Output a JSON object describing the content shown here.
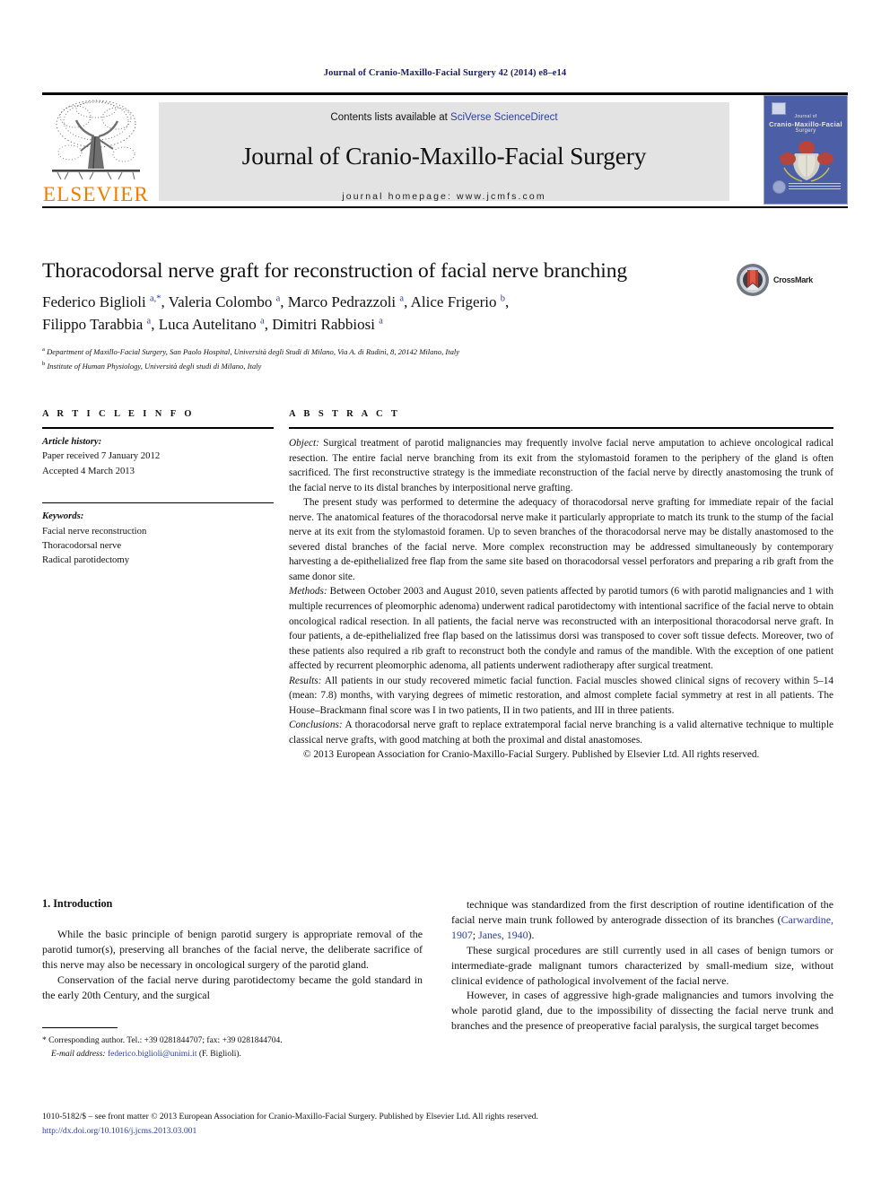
{
  "running_head": "Journal of Cranio-Maxillo-Facial Surgery 42 (2014) e8–e14",
  "masthead": {
    "publisher_logo_text": "ELSEVIER",
    "contents_line_prefix": "Contents lists available at ",
    "contents_line_link": "SciVerse ScienceDirect",
    "journal_title": "Journal of Cranio-Maxillo-Facial Surgery",
    "homepage_line": "journal homepage: www.jcmfs.com",
    "cover": {
      "line1": "Journal of",
      "line2": "Cranio-Maxillo-Facial",
      "line3": "Surgery",
      "bg_color": "#4c5fa6"
    },
    "accent_orange": "#F07D00",
    "link_color": "#2a3fa0"
  },
  "article": {
    "title": "Thoracodorsal nerve graft for reconstruction of facial nerve branching",
    "crossmark_label": "CrossMark",
    "authors_line1": "Federico Biglioli <sup>a,*</sup>, Valeria Colombo <sup>a</sup>, Marco Pedrazzoli <sup>a</sup>, Alice Frigerio <sup>b</sup>,",
    "authors_line2": "Filippo Tarabbia <sup>a</sup>, Luca Autelitano <sup>a</sup>, Dimitri Rabbiosi <sup>a</sup>",
    "affiliation_a": "<sup>a</sup> Department of Maxillo-Facial Surgery, San Paolo Hospital, Università degli Studi di Milano, Via A. di Rudinì, 8, 20142 Milano, Italy",
    "affiliation_b": "<sup>b</sup> Institute of Human Physiology, Università degli studi di Milano, Italy"
  },
  "article_info": {
    "heading": "A R T I C L E   I N F O",
    "history_label": "Article history:",
    "history_lines": [
      "Paper received 7 January 2012",
      "Accepted 4 March 2013"
    ],
    "keywords_label": "Keywords:",
    "keywords": [
      "Facial nerve reconstruction",
      "Thoracodorsal nerve",
      "Radical parotidectomy"
    ]
  },
  "abstract": {
    "heading": "A B S T R A C T",
    "paragraphs": [
      {
        "label": "Object:",
        "indent": false,
        "text": " Surgical treatment of parotid malignancies may frequently involve facial nerve amputation to achieve oncological radical resection. The entire facial nerve branching from its exit from the stylomastoid foramen to the periphery of the gland is often sacrificed. The first reconstructive strategy is the immediate reconstruction of the facial nerve by directly anastomosing the trunk of the facial nerve to its distal branches by interpositional nerve grafting."
      },
      {
        "label": "",
        "indent": true,
        "text": "The present study was performed to determine the adequacy of thoracodorsal nerve grafting for immediate repair of the facial nerve. The anatomical features of the thoracodorsal nerve make it particularly appropriate to match its trunk to the stump of the facial nerve at its exit from the stylomastoid foramen. Up to seven branches of the thoracodorsal nerve may be distally anastomosed to the severed distal branches of the facial nerve. More complex reconstruction may be addressed simultaneously by contemporary harvesting a de-epithelialized free flap from the same site based on thoracodorsal vessel perforators and preparing a rib graft from the same donor site."
      },
      {
        "label": "Methods:",
        "indent": false,
        "text": " Between October 2003 and August 2010, seven patients affected by parotid tumors (6 with parotid malignancies and 1 with multiple recurrences of pleomorphic adenoma) underwent radical parotidectomy with intentional sacrifice of the facial nerve to obtain oncological radical resection. In all patients, the facial nerve was reconstructed with an interpositional thoracodorsal nerve graft. In four patients, a de-epithelialized free flap based on the latissimus dorsi was transposed to cover soft tissue defects. Moreover, two of these patients also required a rib graft to reconstruct both the condyle and ramus of the mandible. With the exception of one patient affected by recurrent pleomorphic adenoma, all patients underwent radiotherapy after surgical treatment."
      },
      {
        "label": "Results:",
        "indent": false,
        "text": " All patients in our study recovered mimetic facial function. Facial muscles showed clinical signs of recovery within 5–14 (mean: 7.8) months, with varying degrees of mimetic restoration, and almost complete facial symmetry at rest in all patients. The House–Brackmann final score was I in two patients, II in two patients, and III in three patients."
      },
      {
        "label": "Conclusions:",
        "indent": false,
        "text": " A thoracodorsal nerve graft to replace extratemporal facial nerve branching is a valid alternative technique to multiple classical nerve grafts, with good matching at both the proximal and distal anastomoses."
      }
    ],
    "copyright": "© 2013 European Association for Cranio-Maxillo-Facial Surgery. Published by Elsevier Ltd. All rights reserved."
  },
  "introduction": {
    "heading": "1. Introduction",
    "left_paragraphs": [
      "While the basic principle of benign parotid surgery is appropriate removal of the parotid tumor(s), preserving all branches of the facial nerve, the deliberate sacrifice of this nerve may also be necessary in oncological surgery of the parotid gland.",
      "Conservation of the facial nerve during parotidectomy became the gold standard in the early 20th Century, and the surgical"
    ],
    "right_paragraphs": [
      "technique was standardized from the first description of routine identification of the facial nerve main trunk followed by anterograde dissection of its branches (<span class=\"cite\">Carwardine, 1907</span>; <span class=\"cite\">Janes, 1940</span>).",
      "These surgical procedures are still currently used in all cases of benign tumors or intermediate-grade malignant tumors characterized by small-medium size, without clinical evidence of pathological involvement of the facial nerve.",
      "However, in cases of aggressive high-grade malignancies and tumors involving the whole parotid gland, due to the impossibility of dissecting the facial nerve trunk and branches and the presence of preoperative facial paralysis, the surgical target becomes"
    ]
  },
  "footnote": {
    "line1": "* Corresponding author. Tel.: +39 0281844707; fax: +39 0281844704.",
    "email_label": "E-mail address:",
    "email": "federico.biglioli@unimi.it",
    "email_suffix": " (F. Biglioli)."
  },
  "bottom": {
    "issn_line": "1010-5182/$ – see front matter © 2013 European Association for Cranio-Maxillo-Facial Surgery. Published by Elsevier Ltd. All rights reserved.",
    "doi": "http://dx.doi.org/10.1016/j.jcms.2013.03.001"
  }
}
